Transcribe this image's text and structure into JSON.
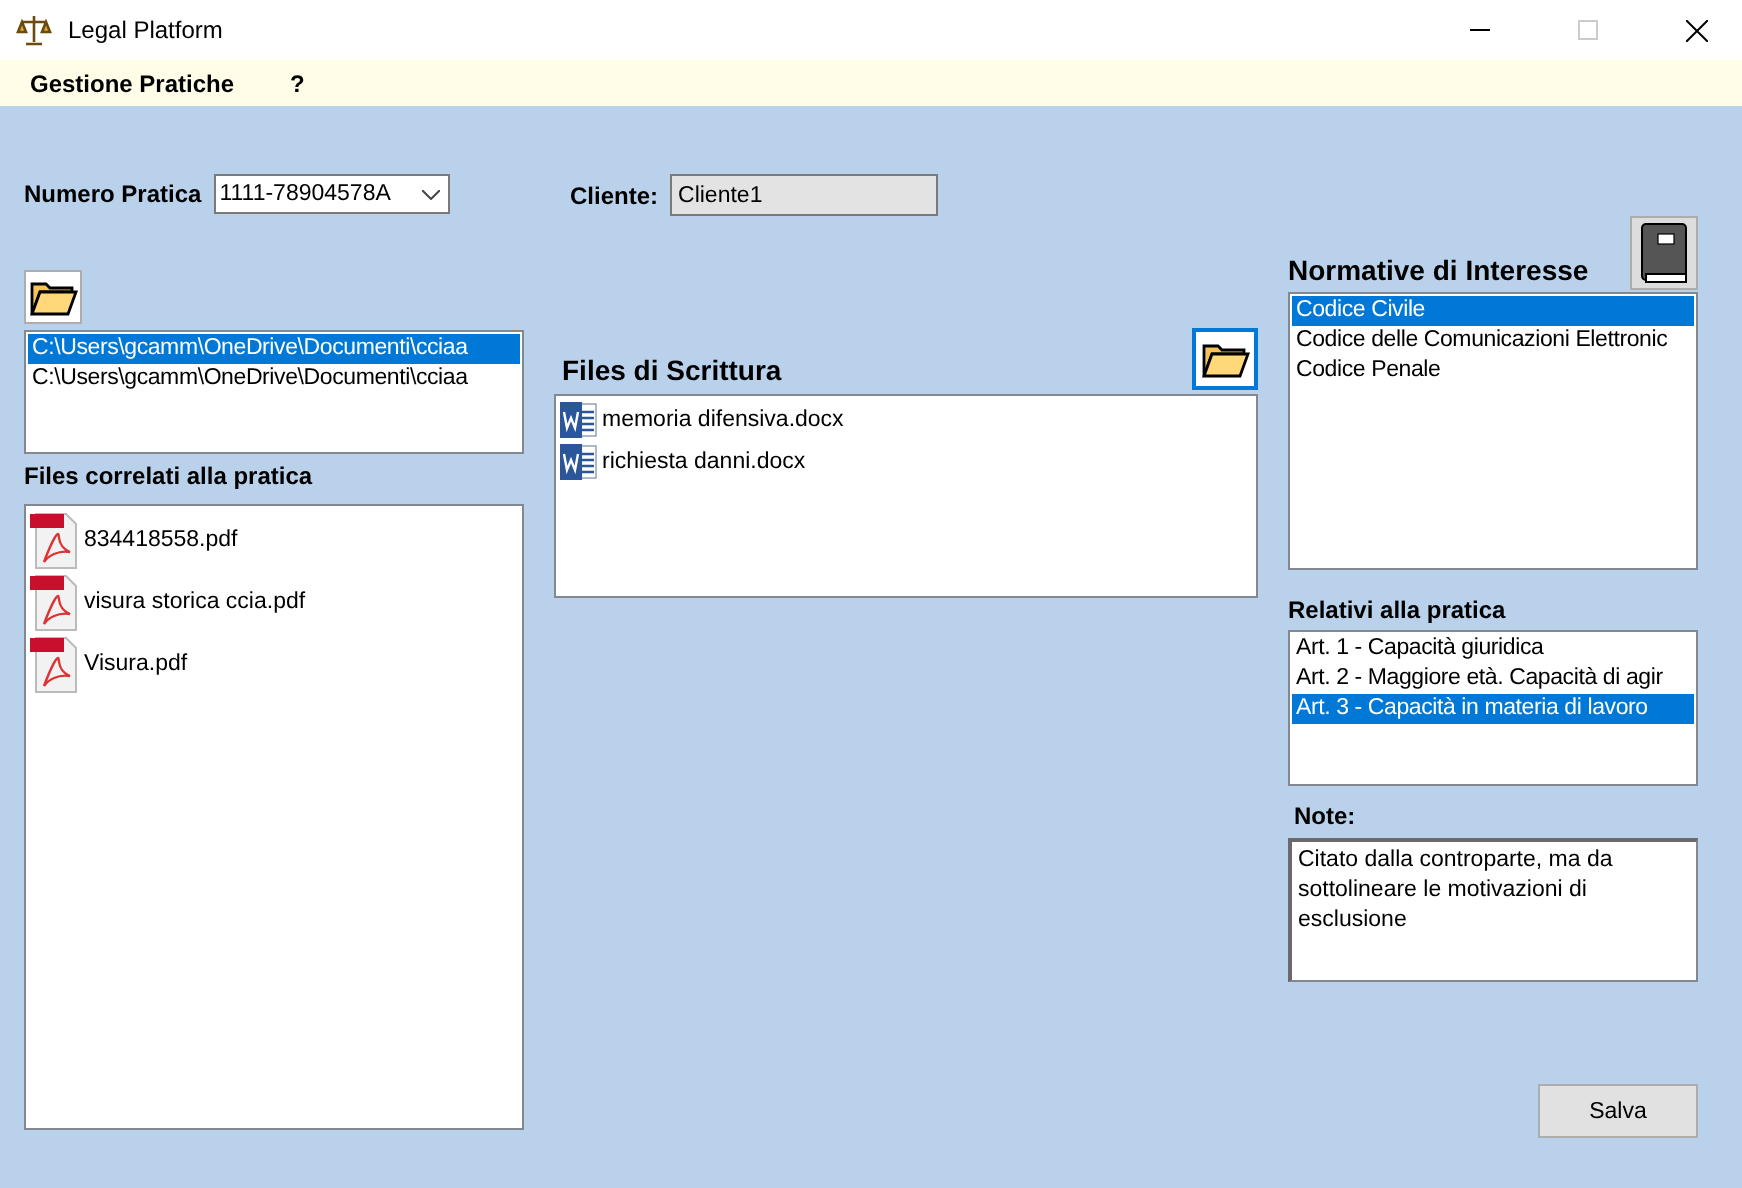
{
  "window": {
    "title": "Legal Platform"
  },
  "menu": [
    {
      "label": "Gestione Pratiche"
    },
    {
      "label": "?"
    }
  ],
  "numero_pratica": {
    "label": "Numero Pratica",
    "value": "1111-78904578A"
  },
  "cliente": {
    "label": "Cliente:",
    "value": "Cliente1"
  },
  "paths": [
    {
      "text": "C:\\Users\\gcamm\\OneDrive\\Documenti\\cciaa",
      "selected": true
    },
    {
      "text": "C:\\Users\\gcamm\\OneDrive\\Documenti\\cciaa",
      "selected": false
    }
  ],
  "files_correlati": {
    "label": "Files correlati alla pratica",
    "items": [
      {
        "name": "834418558.pdf"
      },
      {
        "name": "visura storica ccia.pdf"
      },
      {
        "name": "Visura.pdf"
      }
    ]
  },
  "files_scrittura": {
    "title": "Files di Scrittura",
    "button_focused": true,
    "items": [
      {
        "name": "memoria difensiva.docx"
      },
      {
        "name": "richiesta danni.docx"
      }
    ]
  },
  "normative": {
    "title": "Normative di Interesse",
    "items": [
      {
        "text": "Codice Civile",
        "selected": true
      },
      {
        "text": "Codice delle Comunicazioni Elettronic",
        "selected": false
      },
      {
        "text": "Codice Penale",
        "selected": false
      }
    ]
  },
  "relativi": {
    "label": "Relativi alla pratica",
    "items": [
      {
        "text": "Art. 1 - Capacità giuridica",
        "selected": false
      },
      {
        "text": "Art. 2 - Maggiore età. Capacità di agir",
        "selected": false
      },
      {
        "text": "Art. 3 - Capacità in materia di lavoro",
        "selected": true
      }
    ]
  },
  "note": {
    "label": "Note:",
    "value": "Citato dalla controparte, ma da sottolineare le motivazioni di esclusione"
  },
  "save_button": {
    "label": "Salva"
  }
}
